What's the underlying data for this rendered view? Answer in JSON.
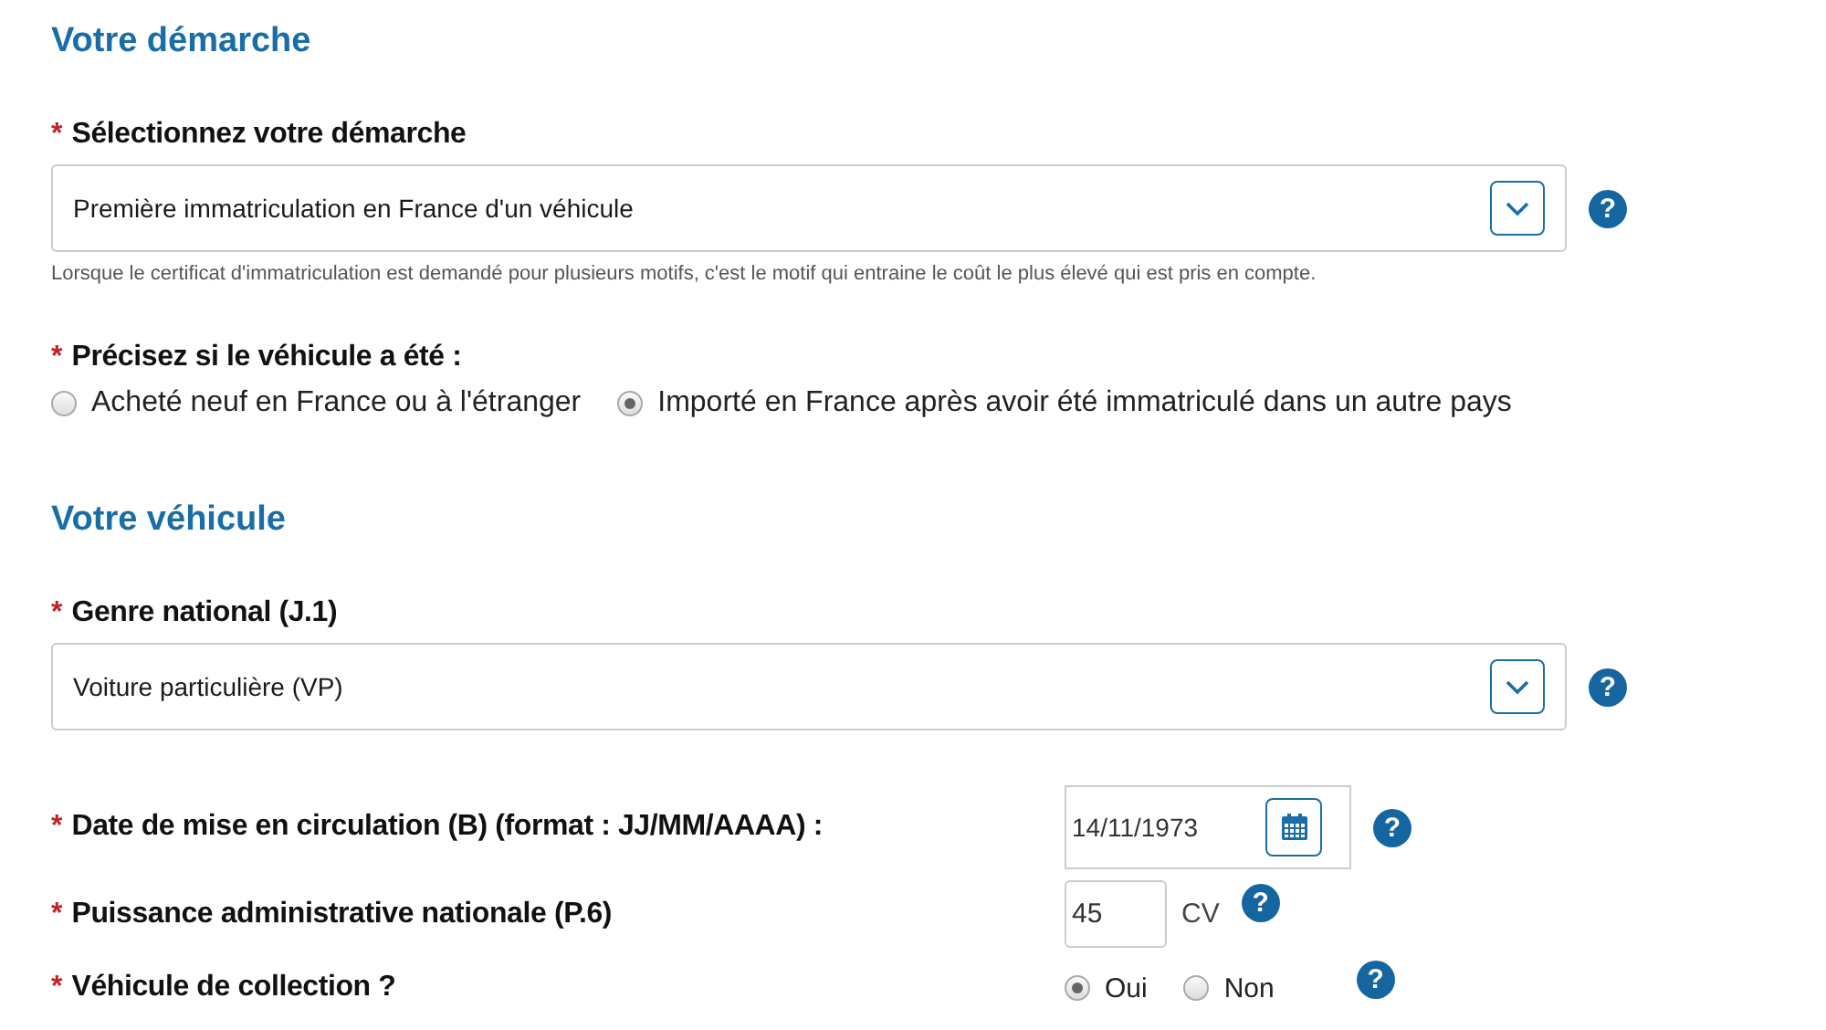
{
  "sections": [
    {
      "title": "Votre démarche",
      "fields": [
        {
          "kind": "select",
          "required": "*",
          "label": "Sélectionnez votre démarche",
          "value": "Première immatriculation en France d'un véhicule",
          "help": "?",
          "hint": "Lorsque le certificat d'immatriculation est demandé pour plusieurs motifs, c'est le motif qui entraine le coût le plus élevé qui est pris en compte."
        },
        {
          "kind": "radios",
          "required": "*",
          "label": "Précisez si le véhicule a été :",
          "options": [
            {
              "label": "Acheté neuf en France ou à l'étranger",
              "selected": false
            },
            {
              "label": "Importé en France après avoir été immatriculé dans un autre pays",
              "selected": true
            }
          ]
        }
      ]
    },
    {
      "title": "Votre véhicule",
      "fields": [
        {
          "kind": "select",
          "required": "*",
          "label": "Genre national (J.1)",
          "value": "Voiture particulière (VP)",
          "help": "?"
        },
        {
          "kind": "date",
          "required": "*",
          "label": "Date de mise en circulation (B) (format : JJ/MM/AAAA) :",
          "value": "14/11/1973",
          "help": "?"
        },
        {
          "kind": "number",
          "required": "*",
          "label": "Puissance administrative nationale (P.6)",
          "value": "45",
          "unit": "CV",
          "help": "?"
        },
        {
          "kind": "inline-radios",
          "required": "*",
          "label": "Véhicule de collection ?",
          "options": [
            {
              "label": "Oui",
              "selected": true
            },
            {
              "label": "Non",
              "selected": false
            }
          ],
          "help": "?"
        }
      ]
    }
  ]
}
